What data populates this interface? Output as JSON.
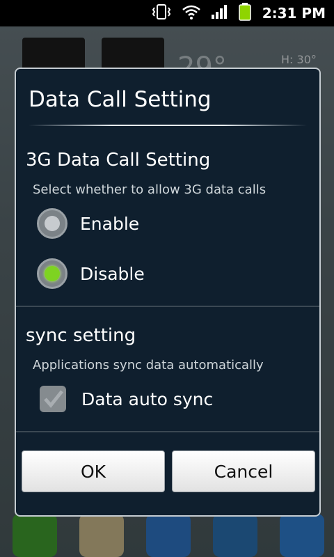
{
  "status_bar": {
    "time": "2:31 PM",
    "icons": [
      "vibrate-icon",
      "wifi-icon",
      "signal-icon",
      "battery-icon"
    ]
  },
  "background": {
    "temperature": "29°",
    "high": "H: 30°"
  },
  "dialog": {
    "title": "Data Call Setting",
    "sections": [
      {
        "heading": "3G Data Call Setting",
        "description": "Select whether to allow 3G data calls",
        "options": [
          {
            "label": "Enable",
            "selected": false
          },
          {
            "label": "Disable",
            "selected": true
          }
        ]
      },
      {
        "heading": "sync setting",
        "description": "Applications sync data automatically",
        "checkbox": {
          "label": "Data auto sync",
          "checked": true
        }
      }
    ],
    "buttons": {
      "ok": "OK",
      "cancel": "Cancel"
    }
  },
  "colors": {
    "dialog_bg": "#0f1f2e",
    "radio_selected": "#7ed321",
    "radio_unselected": "#c7cbcf",
    "battery": "#8fd400"
  }
}
